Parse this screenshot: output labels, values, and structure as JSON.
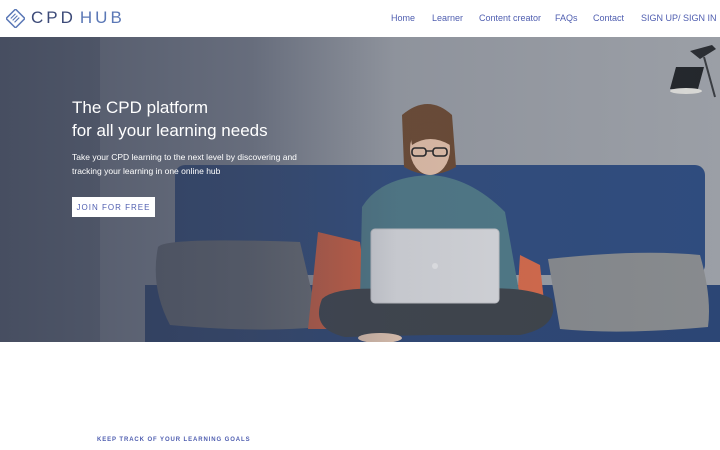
{
  "brand": {
    "name_part1": "CPD",
    "name_part2": "HUB"
  },
  "nav": {
    "items": [
      {
        "label": "Home"
      },
      {
        "label": "Learner"
      },
      {
        "label": "Content creator"
      },
      {
        "label": "FAQs"
      },
      {
        "label": "Contact"
      },
      {
        "label": "SIGN UP/ SIGN IN"
      }
    ]
  },
  "hero": {
    "title_line1": "The CPD platform",
    "title_line2": "for all your learning needs",
    "text": "Take your CPD learning to the next level by discovering and tracking your learning in one online hub",
    "cta_label": "JOIN FOR FREE"
  },
  "section": {
    "heading": "KEEP TRACK OF YOUR LEARNING GOALS"
  },
  "colors": {
    "accent": "#4f5eb0",
    "logo_dark": "#3c4a78",
    "logo_light": "#5b78b6"
  }
}
